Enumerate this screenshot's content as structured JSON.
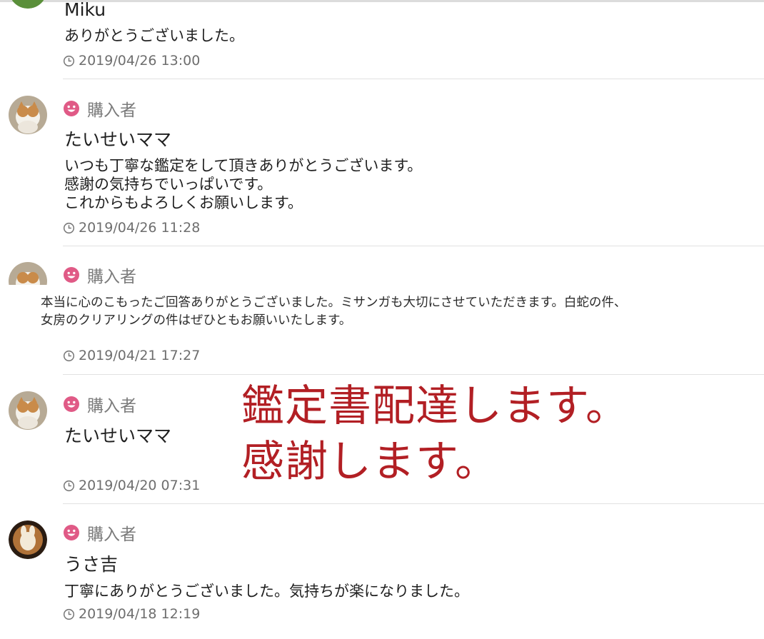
{
  "badge_label": "購入者",
  "comments": [
    {
      "username": "Miku",
      "lines": [
        "ありがとうございました。"
      ],
      "time": "2019/04/26 13:00"
    },
    {
      "badge": "購入者",
      "username": "たいせいママ",
      "lines": [
        "いつも丁寧な鑑定をして頂きありがとうございます。",
        "感謝の気持ちでいっぱいです。",
        "これからもよろしくお願いします。"
      ],
      "time": "2019/04/26 11:28"
    },
    {
      "badge": "購入者",
      "lines": [
        "本当に心のこもったご回答ありがとうございました。ミサンガも大切にさせていただきます。白蛇の件、",
        "女房のクリアリングの件はぜひともお願いいたします。"
      ],
      "time": "2019/04/21 17:27"
    },
    {
      "badge": "購入者",
      "username": "たいせいママ",
      "time": "2019/04/20 07:31"
    },
    {
      "badge": "購入者",
      "username": "うさ吉",
      "lines": [
        "丁寧にありがとうございました。気持ちが楽になりました。"
      ],
      "time": "2019/04/18 12:19"
    }
  ],
  "overlay_text": {
    "line1": "鑑定書配達します。",
    "line2": "感謝します。"
  },
  "colors": {
    "badge_icon": "#e05a86",
    "overlay": "#b21f24",
    "divider": "#e2e2e2"
  },
  "icons": {
    "badge": "smiley-face-icon",
    "timestamp": "clock-icon"
  }
}
